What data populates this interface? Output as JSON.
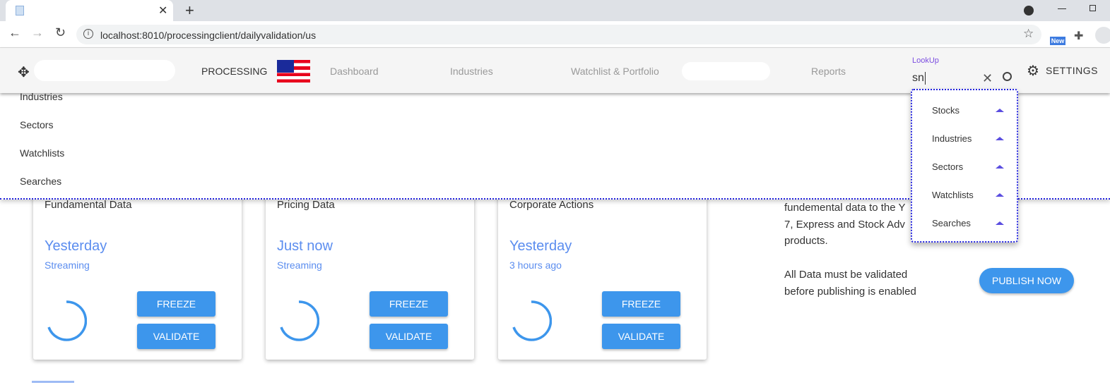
{
  "browser": {
    "url": "localhost:8010/processingclient/dailyvalidation/us",
    "extension_badge": "New"
  },
  "header": {
    "brand": "PROCESSING",
    "nav": [
      "Dashboard",
      "Industries",
      "Watchlist & Portfolio",
      "Reports"
    ],
    "lookup_label": "LookUp",
    "lookup_value": "sn",
    "settings": "SETTINGS"
  },
  "overlay_items": [
    "Industries",
    "Sectors",
    "Watchlists",
    "Searches"
  ],
  "lookup_options": [
    "Stocks",
    "Industries",
    "Sectors",
    "Watchlists",
    "Searches"
  ],
  "cards": [
    {
      "title": "Fundamental Data",
      "when": "Yesterday",
      "status": "Streaming",
      "freeze": "FREEZE",
      "validate": "VALIDATE"
    },
    {
      "title": "Pricing Data",
      "when": "Just now",
      "status": "Streaming",
      "freeze": "FREEZE",
      "validate": "VALIDATE"
    },
    {
      "title": "Corporate Actions",
      "when": "Yesterday",
      "status": "3 hours ago",
      "freeze": "FREEZE",
      "validate": "VALIDATE"
    }
  ],
  "publish": {
    "line1": "fundemental data to the Y",
    "line2": "7, Express and Stock Adv",
    "line3": "products.",
    "note1": "All Data must be validated",
    "note2": "before publishing is enabled",
    "button": "PUBLISH NOW"
  },
  "colors": {
    "accent": "#3d96ec",
    "link": "#5b8def",
    "lookup": "#7b4de0"
  }
}
